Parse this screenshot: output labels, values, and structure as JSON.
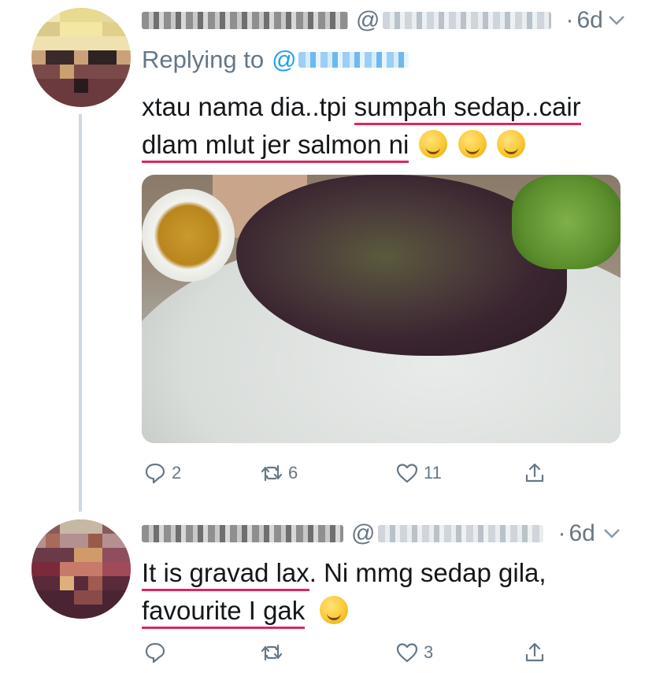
{
  "tweets": [
    {
      "time": "6d",
      "replying_prefix": "Replying to",
      "replying_at": "@",
      "text_line1_plain": "xtau nama dia..tpi ",
      "text_line1_underlined": "sumpah sedap..cair",
      "text_line2_underlined": "dlam mlut jer salmon ni",
      "emojis": [
        "face-savoring-food-icon",
        "drooling-face-icon",
        "drooling-face-icon"
      ],
      "actions": {
        "reply_count": "2",
        "retweet_count": "6",
        "like_count": "11"
      }
    },
    {
      "time": "6d",
      "text_line1_underlined": "It is gravad lax",
      "text_line1_plain": ". Ni mmg sedap gila,",
      "text_line2_underlined": "favourite I gak",
      "emojis": [
        "grinning-face-icon"
      ],
      "actions": {
        "reply_count": "",
        "retweet_count": "",
        "like_count": "3"
      }
    }
  ],
  "colors": {
    "secondary_text": "#657786",
    "mention_blue": "#1da1f2",
    "underline_red": "#e0245e",
    "thread_line": "#cfd9de"
  }
}
